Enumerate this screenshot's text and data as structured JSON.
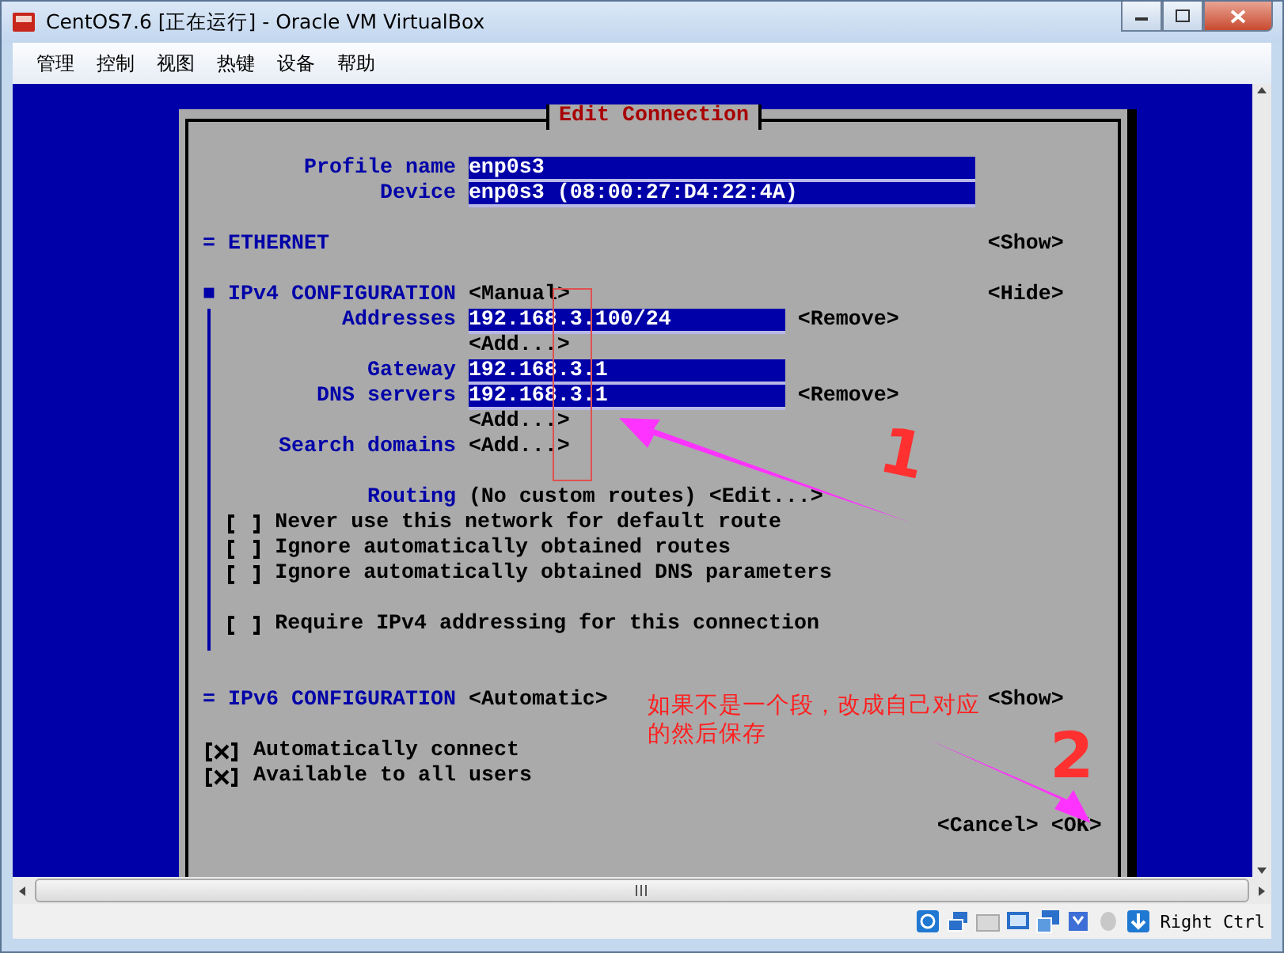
{
  "window": {
    "title": "CentOS7.6 [正在运行] - Oracle VM VirtualBox"
  },
  "menu": [
    "管理",
    "控制",
    "视图",
    "热键",
    "设备",
    "帮助"
  ],
  "dialog": {
    "title": "Edit Connection",
    "profile": [
      {
        "label": "Profile name",
        "value": "enp0s3"
      },
      {
        "label": "Device",
        "value": "enp0s3 (08:00:27:D4:22:4A)"
      }
    ],
    "ethernet": {
      "marker": "=",
      "heading": "ETHERNET",
      "toggle": "<Show>"
    },
    "ipv4": {
      "marker": "■",
      "heading": "IPv4 CONFIGURATION",
      "mode": "<Manual>",
      "toggle": "<Hide>",
      "groups": [
        {
          "rows": [
            {
              "kind": "field",
              "label": "Addresses",
              "value": "192.168.3.100/24",
              "action": "<Remove>"
            },
            {
              "kind": "add",
              "button": "<Add...>"
            },
            {
              "kind": "field",
              "label": "Gateway",
              "value": "192.168.3.1"
            },
            {
              "kind": "field",
              "label": "DNS servers",
              "value": "192.168.3.1",
              "action": "<Remove>"
            },
            {
              "kind": "add",
              "button": "<Add...>"
            },
            {
              "kind": "add",
              "label": "Search domains",
              "button": "<Add...>"
            }
          ]
        },
        {
          "rows": [
            {
              "kind": "routing",
              "label": "Routing",
              "value": "(No custom routes)",
              "button": "<Edit...>"
            },
            {
              "kind": "checkbox",
              "label": "Never use this network for default route",
              "checked": false
            },
            {
              "kind": "checkbox",
              "label": "Ignore automatically obtained routes",
              "checked": false
            },
            {
              "kind": "checkbox",
              "label": "Ignore automatically obtained DNS parameters",
              "checked": false
            }
          ]
        },
        {
          "rows": [
            {
              "kind": "checkbox",
              "label": "Require IPv4 addressing for this connection",
              "checked": false
            }
          ]
        }
      ]
    },
    "ipv6": {
      "marker": "=",
      "heading": "IPv6 CONFIGURATION",
      "mode": "<Automatic>",
      "toggle": "<Show>"
    },
    "options": [
      {
        "label": "Automatically connect",
        "checked": true
      },
      {
        "label": "Available to all users",
        "checked": true
      }
    ],
    "buttons": [
      "<Cancel>",
      "<OK>"
    ]
  },
  "annotations": {
    "note": "如果不是一个段，改成自己对应的然后保存",
    "steps": [
      "1",
      "2"
    ]
  },
  "status_bar": {
    "host_key": "Right Ctrl"
  }
}
